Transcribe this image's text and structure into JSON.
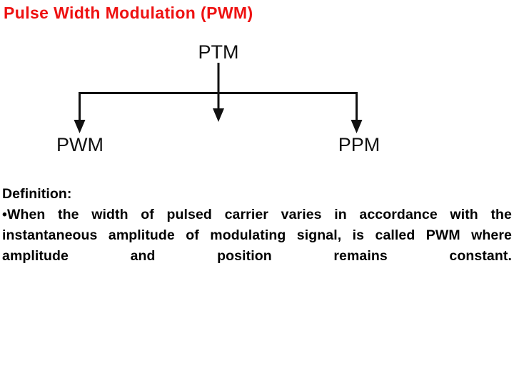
{
  "slide": {
    "title": "Pulse Width Modulation (PWM)",
    "title_color": "#ee1111",
    "background_color": "#ffffff",
    "body_text_color": "#000000"
  },
  "diagram": {
    "name": "ptm-classification-tree",
    "type": "tree",
    "line_color": "#111111",
    "root": {
      "label": "PTM"
    },
    "children": [
      {
        "label": "PWM"
      },
      {
        "label": "PPM"
      }
    ]
  },
  "definition": {
    "heading": "Definition:",
    "bullet": "•",
    "body": "When the width of pulsed carrier varies in accordance with the instantaneous amplitude of modulating signal, is called PWM where amplitude and position remains constant.",
    "lines": [
      "When the width of pulsed carrier varies in",
      "accordance with the instantaneous amplitude of",
      "modulating signal, is called PWM where amplitude",
      "and position remains constant."
    ]
  }
}
